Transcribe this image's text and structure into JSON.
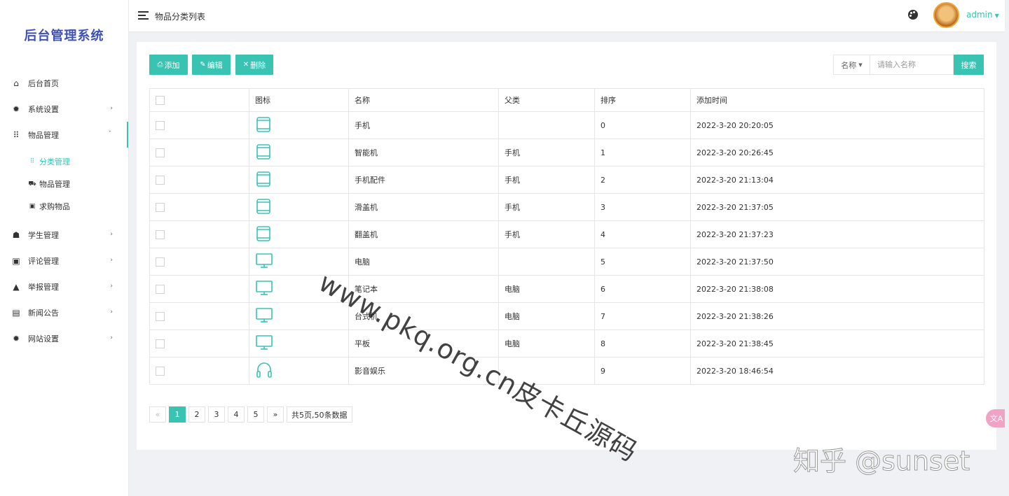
{
  "app": {
    "title": "后台管理系统"
  },
  "header": {
    "page_title": "物品分类列表",
    "username": "admin",
    "palette_icon": "palette-icon"
  },
  "sidebar": {
    "items": [
      {
        "label": "后台首页",
        "icon": "home-icon",
        "glyph": "⌂"
      },
      {
        "label": "系统设置",
        "icon": "gear-icon",
        "glyph": "✹",
        "arrow": "›"
      },
      {
        "label": "物品管理",
        "icon": "grid-icon",
        "glyph": "⠿",
        "arrow": "ˇ"
      },
      {
        "label": "学生管理",
        "icon": "users-icon",
        "glyph": "☗",
        "arrow": "›"
      },
      {
        "label": "评论管理",
        "icon": "comment-icon",
        "glyph": "▣",
        "arrow": "›"
      },
      {
        "label": "举报管理",
        "icon": "warning-icon",
        "glyph": "▲",
        "arrow": "›"
      },
      {
        "label": "新闻公告",
        "icon": "news-icon",
        "glyph": "▤",
        "arrow": "›"
      },
      {
        "label": "网站设置",
        "icon": "gear-icon",
        "glyph": "✹",
        "arrow": "›"
      }
    ],
    "submenu": [
      {
        "label": "分类管理",
        "glyph": "⠿"
      },
      {
        "label": "物品管理",
        "glyph": "⛟"
      },
      {
        "label": "求购物品",
        "glyph": "▣"
      }
    ]
  },
  "toolbar": {
    "add_label": "添加",
    "edit_label": "编辑",
    "delete_label": "删除"
  },
  "search": {
    "field_label": "名称",
    "placeholder": "请输入名称",
    "button_label": "搜索"
  },
  "table": {
    "columns": [
      "",
      "图标",
      "名称",
      "父类",
      "排序",
      "添加时间"
    ],
    "rows": [
      {
        "icon": "tablet-icon",
        "name": "手机",
        "parent": "",
        "sort": "0",
        "time": "2022-3-20 20:20:05"
      },
      {
        "icon": "tablet-icon",
        "name": "智能机",
        "parent": "手机",
        "sort": "1",
        "time": "2022-3-20 20:26:45"
      },
      {
        "icon": "tablet-icon",
        "name": "手机配件",
        "parent": "手机",
        "sort": "2",
        "time": "2022-3-20 21:13:04"
      },
      {
        "icon": "tablet-icon",
        "name": "滑盖机",
        "parent": "手机",
        "sort": "3",
        "time": "2022-3-20 21:37:05"
      },
      {
        "icon": "tablet-icon",
        "name": "翻盖机",
        "parent": "手机",
        "sort": "4",
        "time": "2022-3-20 21:37:23"
      },
      {
        "icon": "monitor-icon",
        "name": "电脑",
        "parent": "",
        "sort": "5",
        "time": "2022-3-20 21:37:50"
      },
      {
        "icon": "monitor-icon",
        "name": "笔记本",
        "parent": "电脑",
        "sort": "6",
        "time": "2022-3-20 21:38:08"
      },
      {
        "icon": "monitor-icon",
        "name": "台式机",
        "parent": "电脑",
        "sort": "7",
        "time": "2022-3-20 21:38:26"
      },
      {
        "icon": "monitor-icon",
        "name": "平板",
        "parent": "电脑",
        "sort": "8",
        "time": "2022-3-20 21:38:45"
      },
      {
        "icon": "headphones-icon",
        "name": "影音娱乐",
        "parent": "",
        "sort": "9",
        "time": "2022-3-20 18:46:54"
      }
    ]
  },
  "pagination": {
    "prev": "«",
    "pages": [
      "1",
      "2",
      "3",
      "4",
      "5"
    ],
    "current": "1",
    "next": "»",
    "summary": "共5页,50条数据"
  },
  "watermarks": {
    "diagonal": "www.pkq.org.cn皮卡丘源码",
    "zhihu": "知乎 @sunset"
  },
  "translate_button": {
    "label": "文A"
  },
  "colors": {
    "accent": "#38c3b3",
    "brand": "#3f51b5",
    "time_text": "#38b48b"
  }
}
